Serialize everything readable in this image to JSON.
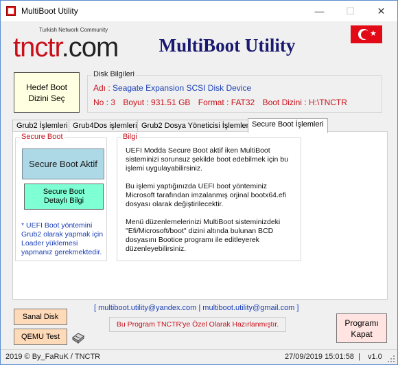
{
  "window": {
    "title": "MultiBoot Utility"
  },
  "logo": {
    "caption": "Turkish Network Community",
    "text_red": "tnctr",
    "text_dark": ".com"
  },
  "header": {
    "title": "MultiBoot Utility"
  },
  "target": {
    "line1": "Hedef Boot",
    "line2": "Dizini Seç"
  },
  "disk": {
    "group_title": "Disk Bilgileri",
    "name_label": "Adı :",
    "name_value": "Seagate Expansion SCSI Disk Device",
    "no": "No : 3",
    "size": "Boyut : 931.51 GB",
    "format": "Format : FAT32",
    "boot_dir": "Boot Dizini : H:\\TNCTR"
  },
  "tabs": [
    {
      "label": "Grub2 İşlemleri"
    },
    {
      "label": "Grub4Dos işlemleri"
    },
    {
      "label": "Grub2 Dosya Yöneticisi İşlemleri"
    },
    {
      "label": "Secure Boot İşlemleri"
    }
  ],
  "secure_boot": {
    "group_title": "Secure Boot",
    "btn_active": "Secure Boot Aktif",
    "btn_detail_line1": "Secure Boot",
    "btn_detail_line2": "Detaylı Bilgi",
    "note": "* UEFI Boot yöntemini Grub2 olarak yapmak için Loader yüklemesi yapmanız gerekmektedir."
  },
  "info": {
    "group_title": "Bilgi",
    "p1": "UEFI Modda Secure Boot aktif iken MultiBoot sisteminizi sorunsuz şekilde boot edebilmek için bu işlemi uygulayabilirsiniz.",
    "p2": "Bu işlemi yaptığınızda UEFI boot yönteminiz Microsoft tarafından imzalanmış orjinal bootx64.efi dosyası olarak değiştirilecektir.",
    "p3": "Menü düzenlemelerinizi MultiBoot sisteminizdeki \"Efi/Microsoft/boot\" dizini altında bulunan BCD dosyasını Bootice programı ile editleyerek düzenleyebilirsiniz."
  },
  "footer": {
    "emails": "[ multiboot.utility@yandex.com | multiboot.utility@gmail.com ]",
    "prepared": "Bu Program TNCTR'ye Özel Olarak Hazırlanmıştır.",
    "sanal_disk": "Sanal Disk",
    "qemu_test": "QEMU Test",
    "close_line1": "Programı",
    "close_line2": "Kapat"
  },
  "status": {
    "copyright": "2019 © By_FaRuK / TNCTR",
    "datetime": "27/09/2019  15:01:58",
    "separator": "|",
    "version": "v1.0"
  },
  "colors": {
    "title_navy": "#191970",
    "label_red": "#c8101a",
    "value_blue": "#1a3fb5",
    "flag_red": "#e30a17"
  }
}
